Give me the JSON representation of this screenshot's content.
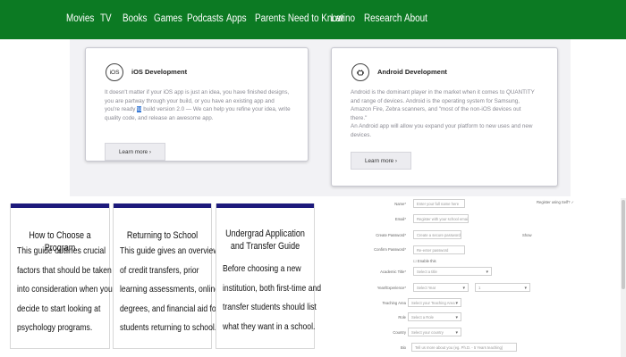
{
  "nav": {
    "items": [
      "Movies",
      "TV",
      "Books",
      "Games",
      "Podcasts",
      "Apps",
      "Parents Need to Know",
      "Latino",
      "Research",
      "About"
    ]
  },
  "cards": {
    "ios": {
      "icon_text": "iOS",
      "title": "iOS Development",
      "body_before": "It doesn't matter if your iOS app is just an idea, you have finished designs, you are partway through your build, or you have an existing app and you're ready ",
      "body_highlight": "to",
      "body_after": " build version 2.0 — We can help you refine your idea, write quality code, and release an awesome app.",
      "button": "Learn more ›"
    },
    "android": {
      "icon": "android-icon",
      "title": "Android Development",
      "body_1": "Android is the dominant player in the market when it comes to QUANTITY and range of devices. Android is the operating system for Samsung, Amazon Fire, Zebra scanners, and \"most of the non-iOS devices out there.\"",
      "body_2": "An Android app will allow you expand your platform to new uses and new devices.",
      "button": "Learn more ›"
    }
  },
  "guides": [
    {
      "title": "How to Choose a Program",
      "body": "This guide outlines crucial factors that should be taken into consideration when you decide to start looking at psychology programs."
    },
    {
      "title": "Returning to School",
      "body": "This guide gives an overview of credit transfers, prior learning assessments, online degrees, and financial aid for students returning to school."
    },
    {
      "title": "Undergrad Application and Transfer Guide",
      "body": "Before choosing a new institution, both first-time and transfer students should list what they want in a school."
    }
  ],
  "form": {
    "top_right_note": "Register using Self? ✓",
    "fields": [
      {
        "label": "Name*",
        "placeholder": "Enter your full name here"
      },
      {
        "label": "Email*",
        "placeholder": "Register with your school email"
      },
      {
        "label": "Create Password*",
        "placeholder": "Create a secure password"
      },
      {
        "label": "Confirm Password*",
        "placeholder": "Re-enter password"
      },
      {
        "label": "Academic Title*",
        "placeholder": "Select a title"
      },
      {
        "label": "Year/Experience*",
        "placeholder": "Select Year"
      },
      {
        "label": "Teaching Area",
        "placeholder": "Select your Teaching Area"
      },
      {
        "label": "Role",
        "placeholder": "Select a Role"
      },
      {
        "label": "Country",
        "placeholder": "Select your country"
      },
      {
        "label": "Bio",
        "placeholder": "Tell us more about you (eg. Ph.D. - 5 Years teaching)"
      }
    ],
    "show_label": "Show",
    "check_label": "Enable this",
    "year_second": "1"
  }
}
